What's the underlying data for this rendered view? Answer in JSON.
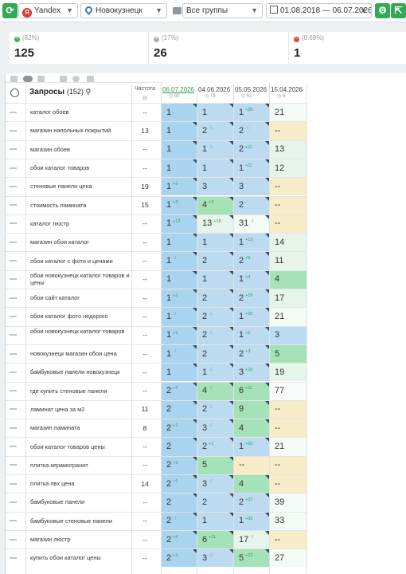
{
  "toolbar": {
    "engine": "Yandex",
    "region": "Новокузнецк",
    "group": "Все группы",
    "date_range": "01.08.2018 — 06.07.2026"
  },
  "stats": [
    {
      "label": "(82%)",
      "value": "125",
      "color": "#3bb45a",
      "glyph": "+"
    },
    {
      "label": "(17%)",
      "value": "26",
      "color": "#a6adb3",
      "glyph": "="
    },
    {
      "label": "(0.69%)",
      "value": "1",
      "color": "#e04747",
      "glyph": "−"
    }
  ],
  "table": {
    "title": "Запросы",
    "count": "(152)",
    "freq_header": "Частота",
    "dates": [
      {
        "date": "06.07.2026",
        "count": "80",
        "active": true
      },
      {
        "date": "04.06.2026",
        "count": "78",
        "active": false
      },
      {
        "date": "05.05.2026",
        "count": "63",
        "active": false
      },
      {
        "date": "15.04.2026",
        "count": "6",
        "active": false
      }
    ],
    "rows": [
      {
        "q": "каталог обоев",
        "f": "--",
        "p": [
          {
            "v": "1",
            "d": ""
          },
          {
            "v": "1",
            "d": ""
          },
          {
            "v": "1",
            "d": "+20"
          },
          {
            "v": "21",
            "d": ""
          }
        ]
      },
      {
        "q": "магазин напольных покрытий",
        "f": "13",
        "p": [
          {
            "v": "1",
            "d": ""
          },
          {
            "v": "2",
            "d": "-1"
          },
          {
            "v": "2",
            "d": "-1"
          },
          {
            "v": "--",
            "d": ""
          }
        ]
      },
      {
        "q": "магазин обоев",
        "f": "--",
        "p": [
          {
            "v": "1",
            "d": ""
          },
          {
            "v": "1",
            "d": "-1"
          },
          {
            "v": "2",
            "d": "+11"
          },
          {
            "v": "13",
            "d": ""
          }
        ]
      },
      {
        "q": "обои каталог товаров",
        "f": "--",
        "p": [
          {
            "v": "1",
            "d": ""
          },
          {
            "v": "1",
            "d": ""
          },
          {
            "v": "1",
            "d": "+11"
          },
          {
            "v": "12",
            "d": ""
          }
        ]
      },
      {
        "q": "стеновые панели цена",
        "f": "19",
        "p": [
          {
            "v": "1",
            "d": "+2"
          },
          {
            "v": "3",
            "d": ""
          },
          {
            "v": "3",
            "d": "-"
          },
          {
            "v": "--",
            "d": ""
          }
        ]
      },
      {
        "q": "стоимость ламината",
        "f": "15",
        "p": [
          {
            "v": "1",
            "d": "+3"
          },
          {
            "v": "4",
            "d": "+2"
          },
          {
            "v": "2",
            "d": "-"
          },
          {
            "v": "--",
            "d": ""
          }
        ]
      },
      {
        "q": "каталог люстр",
        "f": "--",
        "p": [
          {
            "v": "1",
            "d": "+12"
          },
          {
            "v": "13",
            "d": "+18"
          },
          {
            "v": "31",
            "d": "-1"
          },
          {
            "v": "--",
            "d": ""
          }
        ]
      },
      {
        "q": "магазин обои каталог",
        "f": "--",
        "p": [
          {
            "v": "1",
            "d": ""
          },
          {
            "v": "1",
            "d": ""
          },
          {
            "v": "1",
            "d": "+13"
          },
          {
            "v": "14",
            "d": ""
          }
        ]
      },
      {
        "q": "обои каталог с фото и ценами",
        "f": "--",
        "p": [
          {
            "v": "1",
            "d": "-1"
          },
          {
            "v": "2",
            "d": ""
          },
          {
            "v": "2",
            "d": "+9"
          },
          {
            "v": "11",
            "d": ""
          }
        ]
      },
      {
        "q": "обои новокузнецк каталог товаров и цены",
        "f": "--",
        "p": [
          {
            "v": "1",
            "d": ""
          },
          {
            "v": "1",
            "d": ""
          },
          {
            "v": "1",
            "d": "+3"
          },
          {
            "v": "4",
            "d": ""
          }
        ]
      },
      {
        "q": "обои сайт каталог",
        "f": "--",
        "p": [
          {
            "v": "1",
            "d": "+1"
          },
          {
            "v": "2",
            "d": ""
          },
          {
            "v": "2",
            "d": "+15"
          },
          {
            "v": "17",
            "d": ""
          }
        ]
      },
      {
        "q": "обои каталог фото недорого",
        "f": "--",
        "p": [
          {
            "v": "1",
            "d": "-1"
          },
          {
            "v": "2",
            "d": "-1"
          },
          {
            "v": "1",
            "d": "+20"
          },
          {
            "v": "21",
            "d": ""
          }
        ]
      },
      {
        "q": "обои новокузнецк каталог товаров",
        "f": "--",
        "p": [
          {
            "v": "1",
            "d": "+1"
          },
          {
            "v": "2",
            "d": "-1"
          },
          {
            "v": "1",
            "d": "+2"
          },
          {
            "v": "3",
            "d": ""
          }
        ]
      },
      {
        "q": "новокузнецк магазин обои цена",
        "f": "--",
        "p": [
          {
            "v": "1",
            "d": "-1"
          },
          {
            "v": "2",
            "d": ""
          },
          {
            "v": "2",
            "d": "+3"
          },
          {
            "v": "5",
            "d": ""
          }
        ]
      },
      {
        "q": "бамбуковые панели новокузнецк",
        "f": "--",
        "p": [
          {
            "v": "1",
            "d": ""
          },
          {
            "v": "1",
            "d": "-2"
          },
          {
            "v": "3",
            "d": "+16"
          },
          {
            "v": "19",
            "d": ""
          }
        ]
      },
      {
        "q": "где купить стеновые панели",
        "f": "--",
        "p": [
          {
            "v": "2",
            "d": "+2"
          },
          {
            "v": "4",
            "d": "-2"
          },
          {
            "v": "6",
            "d": "+11"
          },
          {
            "v": "77",
            "d": ""
          }
        ]
      },
      {
        "q": "ламинат цена за м2",
        "f": "11",
        "p": [
          {
            "v": "2",
            "d": ""
          },
          {
            "v": "2",
            "d": "-1"
          },
          {
            "v": "9",
            "d": "-"
          },
          {
            "v": "--",
            "d": ""
          }
        ]
      },
      {
        "q": "магазин ламината",
        "f": "8",
        "p": [
          {
            "v": "2",
            "d": "+1"
          },
          {
            "v": "3",
            "d": "-1"
          },
          {
            "v": "4",
            "d": ""
          },
          {
            "v": "--",
            "d": ""
          }
        ]
      },
      {
        "q": "обои каталог товаров цены",
        "f": "--",
        "p": [
          {
            "v": "2",
            "d": ""
          },
          {
            "v": "2",
            "d": "+1"
          },
          {
            "v": "1",
            "d": "+20"
          },
          {
            "v": "21",
            "d": ""
          }
        ]
      },
      {
        "q": "плитка керамогранит",
        "f": "--",
        "p": [
          {
            "v": "2",
            "d": "+3"
          },
          {
            "v": "5",
            "d": "-"
          },
          {
            "v": "--",
            "d": ""
          },
          {
            "v": "--",
            "d": ""
          }
        ]
      },
      {
        "q": "плитка пвх цена",
        "f": "14",
        "p": [
          {
            "v": "2",
            "d": "+1"
          },
          {
            "v": "3",
            "d": "-1"
          },
          {
            "v": "4",
            "d": ""
          },
          {
            "v": "--",
            "d": ""
          }
        ]
      },
      {
        "q": "бамбуковые панели",
        "f": "--",
        "p": [
          {
            "v": "2",
            "d": ""
          },
          {
            "v": "2",
            "d": ""
          },
          {
            "v": "2",
            "d": "+37"
          },
          {
            "v": "39",
            "d": ""
          }
        ]
      },
      {
        "q": "бамбуковые стеновые панели",
        "f": "--",
        "p": [
          {
            "v": "2",
            "d": "-1"
          },
          {
            "v": "1",
            "d": ""
          },
          {
            "v": "1",
            "d": "+32"
          },
          {
            "v": "33",
            "d": ""
          }
        ]
      },
      {
        "q": "магазин люстр",
        "f": "--",
        "p": [
          {
            "v": "2",
            "d": "+4"
          },
          {
            "v": "6",
            "d": "+11"
          },
          {
            "v": "17",
            "d": "-1"
          },
          {
            "v": "--",
            "d": ""
          }
        ]
      },
      {
        "q": "купить обои каталог цены",
        "f": "--",
        "p": [
          {
            "v": "2",
            "d": "+1"
          },
          {
            "v": "3",
            "d": "-2"
          },
          {
            "v": "5",
            "d": "+22"
          },
          {
            "v": "27",
            "d": ""
          }
        ]
      }
    ]
  }
}
